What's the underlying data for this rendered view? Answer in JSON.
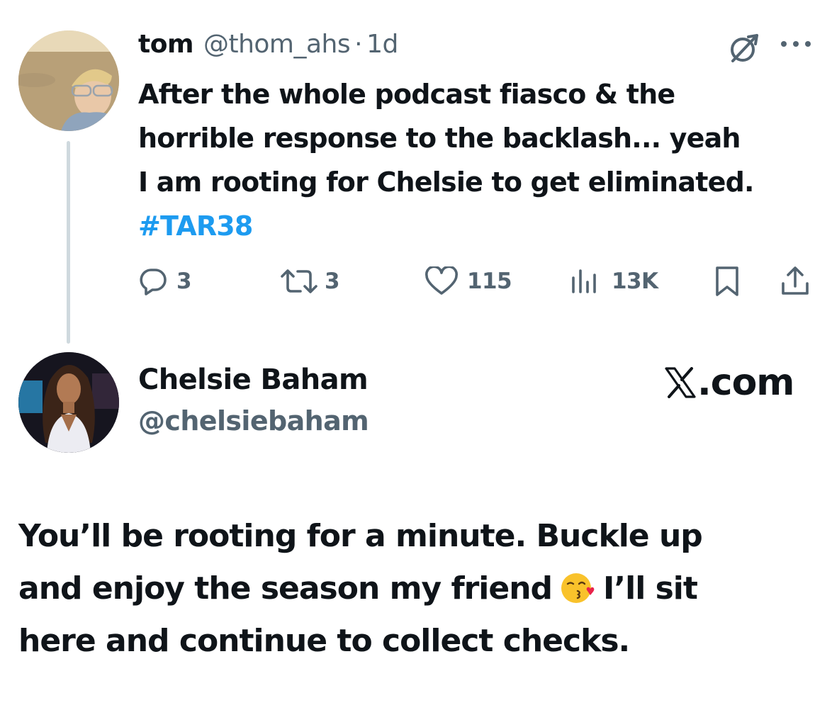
{
  "original_tweet": {
    "display_name": "tom",
    "handle": "@thom_ahs",
    "separator": "·",
    "age": "1d",
    "text_lines": [
      "After the whole podcast fiasco & the",
      "horrible response to the backlash... yeah",
      "I am rooting for Chelsie to get eliminated."
    ],
    "hashtag": "#TAR38",
    "actions": {
      "replies": "3",
      "reposts": "3",
      "likes": "115",
      "views": "13K"
    },
    "icons": {
      "top_right": [
        "grok-icon",
        "more-icon"
      ],
      "actions": [
        "reply-icon",
        "repost-icon",
        "like-icon",
        "views-icon",
        "bookmark-icon",
        "share-icon"
      ]
    }
  },
  "reply_card": {
    "display_name": "Chelsie Baham",
    "handle": "@chelsiebaham",
    "brand": {
      "logo_text": "X",
      "domain_suffix": ".com"
    },
    "text_line_1": "You’ll be rooting for a minute. Buckle up",
    "text_line_2_before": "and enjoy the season my friend",
    "emoji": "face-blowing-kiss",
    "text_line_2_after": "I’ll sit",
    "text_line_3": "here and continue to collect checks."
  },
  "colors": {
    "text": "#0f1419",
    "muted": "#536471",
    "link": "#1d9bf0",
    "thread_line": "#cfd9de"
  }
}
